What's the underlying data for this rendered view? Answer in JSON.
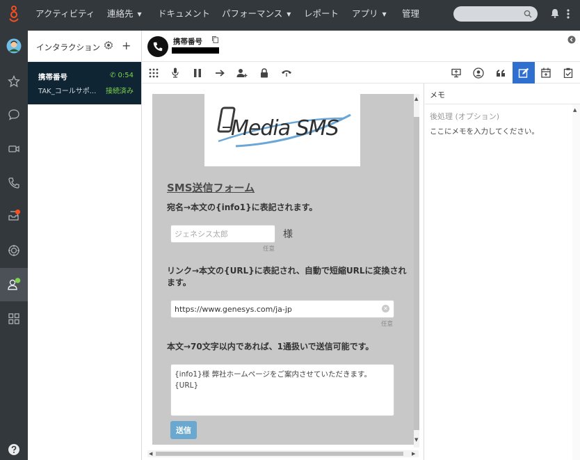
{
  "nav": {
    "items": [
      {
        "label": "アクティビティ",
        "dropdown": false
      },
      {
        "label": "連絡先",
        "dropdown": true
      },
      {
        "label": "ドキュメント",
        "dropdown": false
      },
      {
        "label": "パフォーマンス",
        "dropdown": true
      },
      {
        "label": "レポート",
        "dropdown": false
      },
      {
        "label": "アプリ",
        "dropdown": true
      },
      {
        "label": "管理",
        "dropdown": false
      }
    ],
    "search": {
      "placeholder": "",
      "icon": "search-icon"
    },
    "icons": [
      "genesys-logo-icon",
      "notification-bell-icon",
      "more-vertical-icon"
    ],
    "accent_color": "#ff4f1f"
  },
  "rail": {
    "items": [
      "avatar",
      "star-icon",
      "chat-bubble-icon",
      "video-icon",
      "phone-icon",
      "inbox-icon",
      "target-icon",
      "agent-status-icon",
      "apps-grid-icon",
      "help-icon"
    ],
    "active": "agent-status-icon"
  },
  "interactions": {
    "title": "インタラクション",
    "card": {
      "name": "携帯番号",
      "timer": "0:54",
      "queue": "TAK_コールサポ...",
      "status": "接続済み"
    }
  },
  "conversation": {
    "title": "携帯番号",
    "toolbar": [
      "dialpad-icon",
      "microphone-icon",
      "pause-icon",
      "transfer-arrow-icon",
      "add-participant-icon",
      "lock-icon",
      "hangup-icon"
    ],
    "right_tools": [
      "screen-share-icon",
      "profile-icon",
      "quote-icon",
      "edit-note-icon",
      "schedule-icon",
      "wrapup-icon"
    ],
    "active_tool": "edit-note-icon",
    "active_color": "#2f6fcf"
  },
  "form": {
    "logo_text": "Media SMS",
    "title": "SMS送信フォーム",
    "name_label": "宛名→本文の{info1}に表記されます。",
    "name_placeholder": "ジェネシス太郎",
    "name_suffix": "様",
    "name_hint": "任意",
    "url_label": "リンク→本文の{URL}に表記され、自動で短縮URLに変換されます。",
    "url_value": "https://www.genesys.com/ja-jp",
    "url_hint": "任意",
    "body_label": "本文→70文字以内であれば、1通扱いで送信可能です。",
    "body_line1": "{info1}様 弊社ホームページをご案内させていただきます。",
    "body_line2": "{URL}",
    "send_label": "送信",
    "send_color": "#6aa8cf"
  },
  "memo": {
    "title": "メモ",
    "subtitle": "後処理 (オプション)",
    "placeholder": "ここにメモを入力してください。"
  }
}
